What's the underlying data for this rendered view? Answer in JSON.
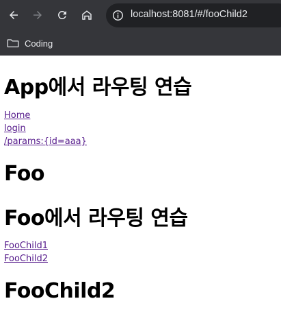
{
  "browser": {
    "url": "localhost:8081/#/fooChild2",
    "bookmarks": [
      {
        "label": "Coding"
      }
    ]
  },
  "page": {
    "app_title": "App에서 라우팅 연습",
    "app_links": [
      "Home",
      "login",
      "/params:{id=aaa}"
    ],
    "foo_title": "Foo",
    "foo_routing_title": "Foo에서 라우팅 연습",
    "foo_links": [
      "FooChild1",
      "FooChild2"
    ],
    "child_title": "FooChild2"
  },
  "colors": {
    "chrome_bg": "#35363a",
    "omnibox_bg": "#202124",
    "visited_link": "#551a8b"
  }
}
